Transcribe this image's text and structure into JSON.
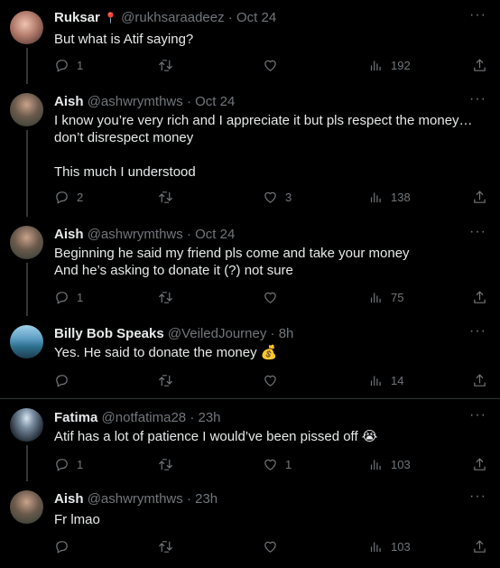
{
  "tweets": [
    {
      "name": "Ruksar",
      "badge": "📍",
      "handle": "@rukhsaraadeez",
      "time": "Oct 24",
      "text": "But what is Atif saying?",
      "replies": "1",
      "retweets": "",
      "likes": "",
      "views": "192"
    },
    {
      "name": "Aish",
      "handle": "@ashwrymthws",
      "time": "Oct 24",
      "text": "I know you’re very rich and I appreciate it but pls respect the money… don’t disrespect money\n\nThis much I understood",
      "replies": "2",
      "retweets": "",
      "likes": "3",
      "views": "138"
    },
    {
      "name": "Aish",
      "handle": "@ashwrymthws",
      "time": "Oct 24",
      "text": "Beginning he said my friend pls come and take your money\nAnd he’s asking to donate it (?) not sure",
      "replies": "1",
      "retweets": "",
      "likes": "",
      "views": "75"
    },
    {
      "name": "Billy Bob Speaks",
      "handle": "@VeiledJourney",
      "time": "8h",
      "text": "Yes. He said to donate the money 💰",
      "replies": "",
      "retweets": "",
      "likes": "",
      "views": "14"
    },
    {
      "name": "Fatima",
      "handle": "@notfatima28",
      "time": "23h",
      "text": "Atif has a lot of patience I would’ve been pissed off 😭",
      "replies": "1",
      "retweets": "",
      "likes": "1",
      "views": "103"
    },
    {
      "name": "Aish",
      "handle": "@ashwrymthws",
      "time": "23h",
      "text": "Fr lmao",
      "replies": "",
      "retweets": "",
      "likes": "",
      "views": "103"
    }
  ],
  "ui": {
    "dot": "·",
    "more": "···"
  },
  "colors": {
    "background": "#000000",
    "text": "#e7e9ea",
    "muted": "#71767b",
    "divider": "#2f3336"
  },
  "icons": [
    "reply-icon",
    "retweet-icon",
    "like-icon",
    "views-icon",
    "share-icon",
    "more-icon"
  ]
}
